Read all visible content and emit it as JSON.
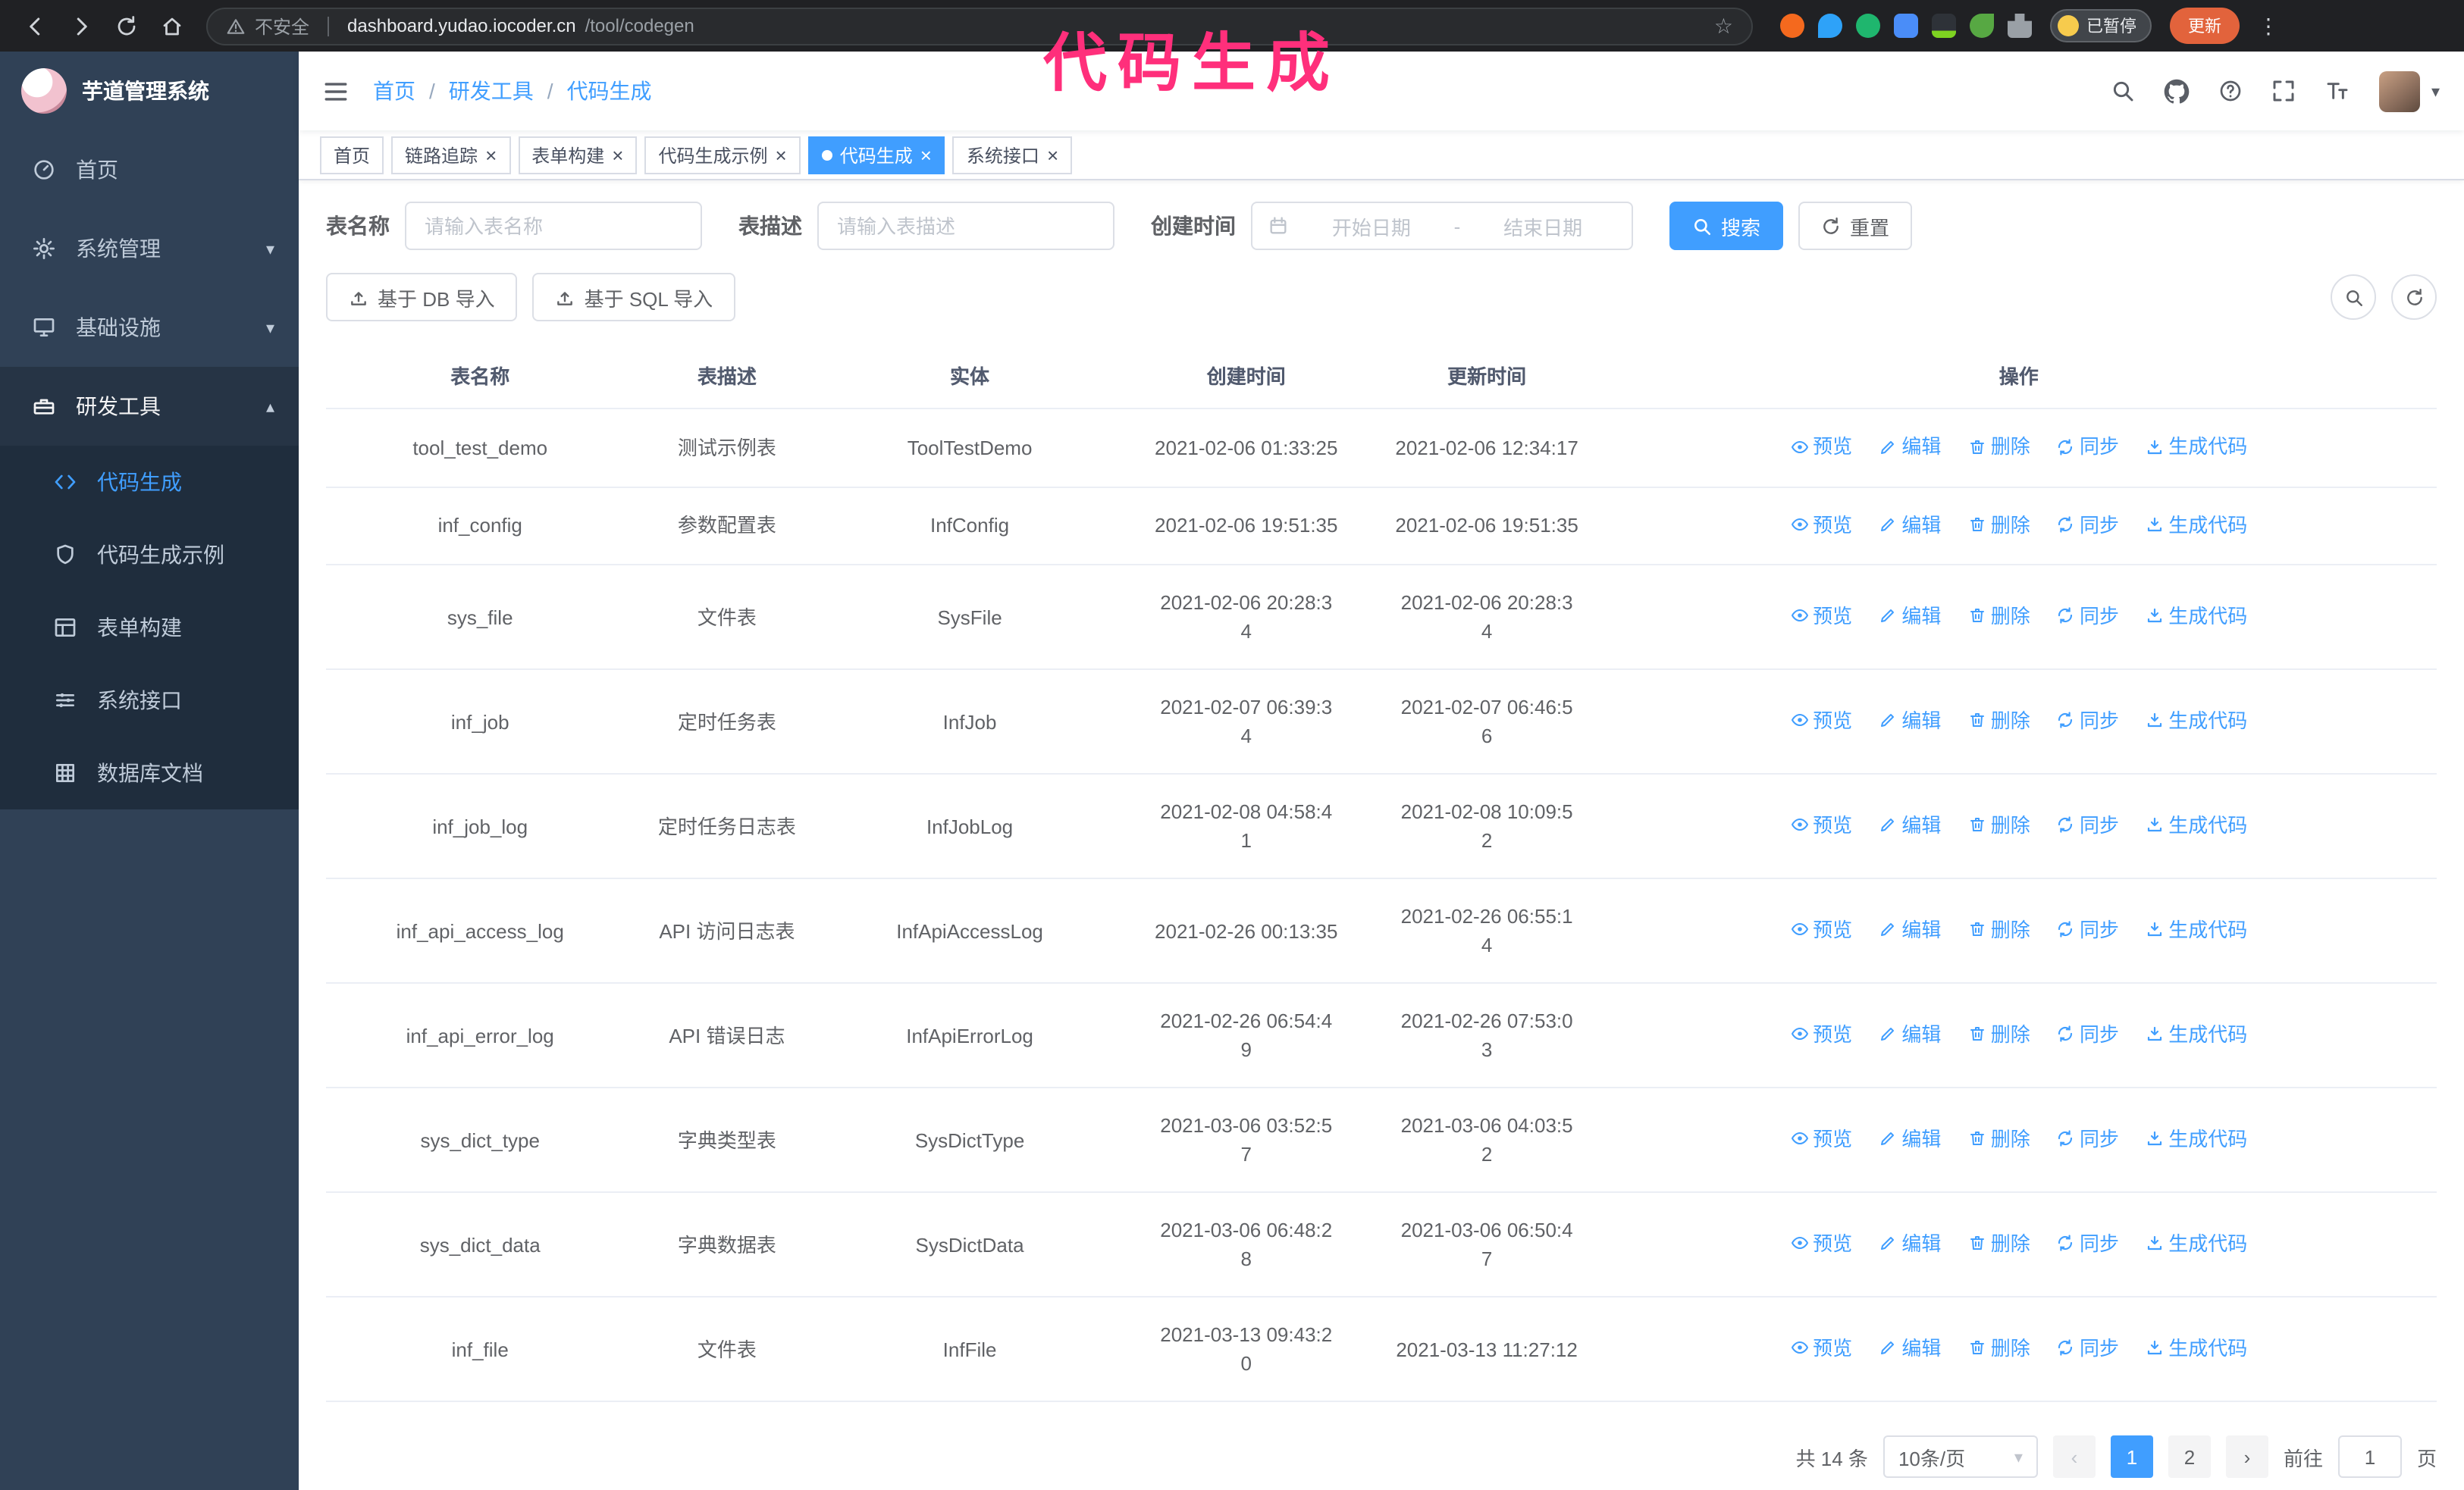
{
  "colors": {
    "primary": "#409eff",
    "annotation_pink": "#ff2f7b",
    "sidebar_bg": "#304156",
    "submenu_bg": "#1f2d3d"
  },
  "browser": {
    "security_label": "不安全",
    "url_domain": "dashboard.yudao.iocoder.cn",
    "url_path": "/tool/codegen",
    "paused_badge": "已暂停",
    "update_button": "更新"
  },
  "annotation": "代码生成",
  "sidebar": {
    "logo_title": "芋道管理系统",
    "items": [
      {
        "label": "首页"
      },
      {
        "label": "系统管理"
      },
      {
        "label": "基础设施"
      },
      {
        "label": "研发工具"
      }
    ],
    "subitems": [
      {
        "label": "代码生成"
      },
      {
        "label": "代码生成示例"
      },
      {
        "label": "表单构建"
      },
      {
        "label": "系统接口"
      },
      {
        "label": "数据库文档"
      }
    ]
  },
  "breadcrumb": {
    "separator": "/",
    "items": [
      "首页",
      "研发工具",
      "代码生成"
    ]
  },
  "tabs": [
    {
      "label": "首页"
    },
    {
      "label": "链路追踪"
    },
    {
      "label": "表单构建"
    },
    {
      "label": "代码生成示例"
    },
    {
      "label": "代码生成"
    },
    {
      "label": "系统接口"
    }
  ],
  "search_form": {
    "table_name_label": "表名称",
    "table_name_placeholder": "请输入表名称",
    "table_desc_label": "表描述",
    "table_desc_placeholder": "请输入表描述",
    "create_time_label": "创建时间",
    "date_start_placeholder": "开始日期",
    "date_separator": "-",
    "date_end_placeholder": "结束日期",
    "search_button": "搜索",
    "reset_button": "重置"
  },
  "toolbar": {
    "import_db_button": "基于 DB 导入",
    "import_sql_button": "基于 SQL 导入"
  },
  "table": {
    "columns": [
      "表名称",
      "表描述",
      "实体",
      "创建时间",
      "更新时间",
      "操作"
    ],
    "action_labels": [
      "预览",
      "编辑",
      "删除",
      "同步",
      "生成代码"
    ],
    "rows": [
      {
        "name": "tool_test_demo",
        "desc": "测试示例表",
        "entity": "ToolTestDemo",
        "created": "2021-02-06 01:33:25",
        "updated": "2021-02-06 12:34:17"
      },
      {
        "name": "inf_config",
        "desc": "参数配置表",
        "entity": "InfConfig",
        "created": "2021-02-06 19:51:35",
        "updated": "2021-02-06 19:51:35"
      },
      {
        "name": "sys_file",
        "desc": "文件表",
        "entity": "SysFile",
        "created": "2021-02-06 20:28:3\n4",
        "updated": "2021-02-06 20:28:3\n4"
      },
      {
        "name": "inf_job",
        "desc": "定时任务表",
        "entity": "InfJob",
        "created": "2021-02-07 06:39:3\n4",
        "updated": "2021-02-07 06:46:5\n6"
      },
      {
        "name": "inf_job_log",
        "desc": "定时任务日志表",
        "entity": "InfJobLog",
        "created": "2021-02-08 04:58:4\n1",
        "updated": "2021-02-08 10:09:5\n2"
      },
      {
        "name": "inf_api_access_log",
        "desc": "API 访问日志表",
        "entity": "InfApiAccessLog",
        "created": "2021-02-26 00:13:35",
        "updated": "2021-02-26 06:55:1\n4"
      },
      {
        "name": "inf_api_error_log",
        "desc": "API 错误日志",
        "entity": "InfApiErrorLog",
        "created": "2021-02-26 06:54:4\n9",
        "updated": "2021-02-26 07:53:0\n3"
      },
      {
        "name": "sys_dict_type",
        "desc": "字典类型表",
        "entity": "SysDictType",
        "created": "2021-03-06 03:52:5\n7",
        "updated": "2021-03-06 04:03:5\n2"
      },
      {
        "name": "sys_dict_data",
        "desc": "字典数据表",
        "entity": "SysDictData",
        "created": "2021-03-06 06:48:2\n8",
        "updated": "2021-03-06 06:50:4\n7"
      },
      {
        "name": "inf_file",
        "desc": "文件表",
        "entity": "InfFile",
        "created": "2021-03-13 09:43:2\n0",
        "updated": "2021-03-13 11:27:12"
      }
    ]
  },
  "pagination": {
    "total_text": "共 14 条",
    "page_size": "10条/页",
    "pages": [
      "1",
      "2"
    ],
    "goto_label": "前往",
    "goto_value": "1",
    "goto_suffix": "页"
  },
  "icons": {
    "caret_down": "▾",
    "caret_up": "▴",
    "close": "×",
    "kebab": "⋮",
    "star": "☆",
    "prev": "‹",
    "next": "›"
  }
}
